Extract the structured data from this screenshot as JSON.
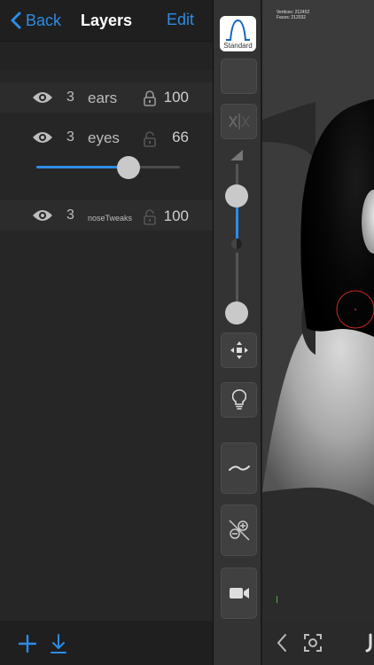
{
  "navbar": {
    "back_label": "Back",
    "title": "Layers",
    "edit_label": "Edit"
  },
  "layers": [
    {
      "count": "3",
      "name": "ears",
      "value": "100",
      "locked": true
    },
    {
      "count": "3",
      "name": "eyes",
      "value": "66",
      "locked": false
    },
    {
      "count": "3",
      "name": "noseTweaks",
      "value": "100",
      "locked": false
    }
  ],
  "layer_slider": {
    "value": 0.64
  },
  "toolbar": {
    "standard_label": "Standard",
    "upper_slider_level": 0.6,
    "lower_slider_level": 0.1,
    "buttons": [
      "material-icon",
      "symmetry-icon",
      "move-icon",
      "light-icon",
      "stroke-icon",
      "mask-icon",
      "camera-icon"
    ]
  },
  "viewport": {
    "vertices_label": "Vertices:",
    "vertices": "212452",
    "faces_label": "Faces:",
    "faces": "212032"
  },
  "colors": {
    "accent": "#2d8ce6",
    "panel": "#262626",
    "toolbar": "#333333",
    "viewport": "#3b3b3b"
  }
}
